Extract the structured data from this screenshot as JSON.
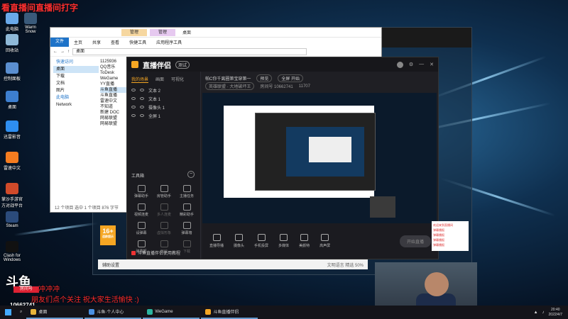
{
  "overlay": {
    "title": "看直播间直播间打字"
  },
  "desktop_icons": [
    {
      "label": "此电脑"
    },
    {
      "label": "回收站"
    },
    {
      "label": "控制面板"
    },
    {
      "label": "桌面"
    },
    {
      "label": "迅雷影音"
    },
    {
      "label": "雷速中文"
    },
    {
      "label": "掌沙手游官方对战平台"
    },
    {
      "label": "Steam"
    },
    {
      "label": "Clash for Windows"
    },
    {
      "label": "Warm Snow"
    }
  ],
  "explorer": {
    "title": "桌面",
    "manage_tab": "管理",
    "manage_tab2": "管理",
    "ribbon": [
      "文件",
      "主页",
      "共享",
      "查看",
      "快捷工具",
      "应用程序工具"
    ],
    "address": "桌面",
    "sidebar": [
      "快速访问",
      "桌面",
      "下载",
      "文档",
      "图片",
      "此电脑",
      "Network"
    ],
    "status": "12 个项目   选中 1 个项目  876 字节",
    "files": [
      "1125936",
      "QQ音乐",
      "ToDesk",
      "WeGame",
      "YY直播",
      "斗鱼直播",
      "斗鱼直播",
      "雷速中文",
      "不知道",
      "新建 DOC",
      "网易联盟",
      "网易联盟"
    ]
  },
  "app": {
    "title": "直播伴侣",
    "beta": "测试",
    "tabs": [
      "我的场景",
      "画面",
      "可视化"
    ],
    "scenes": [
      "文本 2",
      "文本 1",
      "摄像头 1",
      "全屏 1"
    ],
    "room_title": "帕C你千离圈第宝穿第一",
    "room_btn": "预览",
    "room_edit": "全屏 开始",
    "category": "英雄联盟 · 大地破坏王",
    "room_label": "房间号 10662741",
    "viewers": "11707",
    "tools_title": "工具箱",
    "tools": [
      {
        "label": "弹幕助手",
        "dim": false
      },
      {
        "label": "房管助手",
        "dim": false
      },
      {
        "label": "主播任务",
        "dim": false
      },
      {
        "label": "视频连麦",
        "dim": false
      },
      {
        "label": "多人连麦",
        "dim": true
      },
      {
        "label": "精彩助手",
        "dim": false
      },
      {
        "label": "设弹幕",
        "dim": false
      },
      {
        "label": "虚拟形象",
        "dim": true
      },
      {
        "label": "弹幕墙",
        "dim": false
      },
      {
        "label": "弹幕姬",
        "dim": false
      },
      {
        "label": "特效",
        "dim": true
      },
      {
        "label": "下载",
        "dim": true
      }
    ],
    "bottom": [
      "直播导播",
      "摄像头",
      "手机投屏",
      "多媒体",
      "美颜特",
      "高声屏"
    ],
    "go_live": "开始直播",
    "footer": "斗鱼直播伴侣使用教程"
  },
  "aux": {
    "left": "辅助设置",
    "right": "文明语言 精选 50%"
  },
  "badge16": {
    "main": "16+",
    "sub": "适龄提示"
  },
  "stream_overlay": {
    "logo": "斗鱼",
    "room_label": "房间号",
    "room_number": "10662741",
    "chat1": "冲冲冲",
    "chat2": "朋友们点个关注 祝大家生活愉快 :)"
  },
  "right_panel": [
    "欢迎来到直播间",
    "弹幕播报",
    "弹幕播报",
    "弹幕播报",
    "弹幕播报"
  ],
  "taskbar": {
    "items": [
      {
        "label": "桌面",
        "color": "#e8b43a"
      },
      {
        "label": "斗鱼·个人中心",
        "color": "#4a90e2"
      },
      {
        "label": "WeGame",
        "color": "#2bb5a0"
      },
      {
        "label": "斗鱼直播伴侣",
        "color": "#f5a623"
      }
    ],
    "time": "20:40",
    "date": "2022/4/7"
  }
}
